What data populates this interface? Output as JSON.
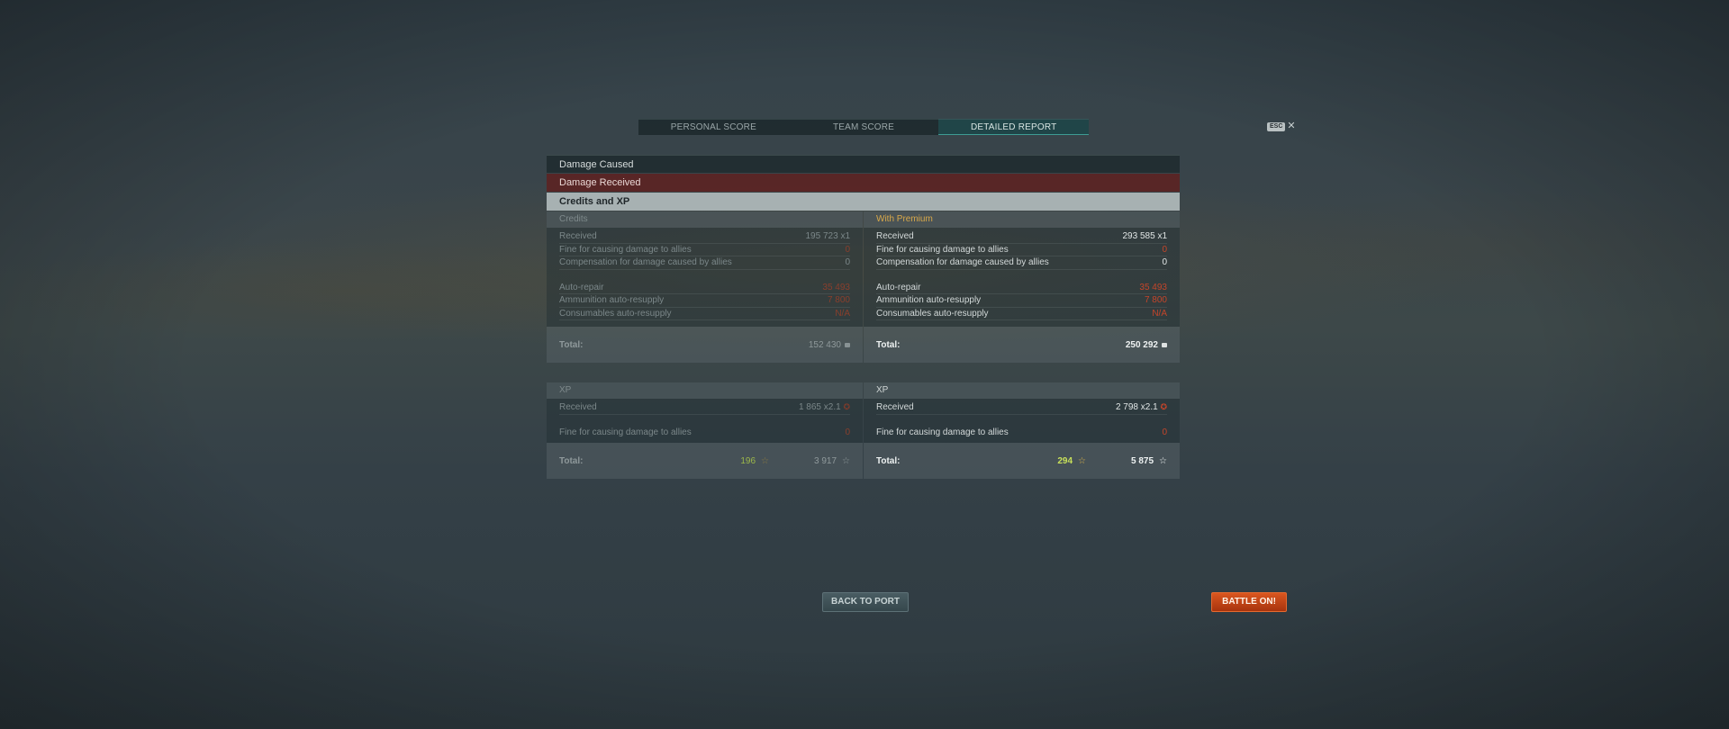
{
  "tabs": [
    {
      "label": "PERSONAL SCORE"
    },
    {
      "label": "TEAM SCORE"
    },
    {
      "label": "DETAILED REPORT"
    }
  ],
  "esc": {
    "badge": "ESC",
    "close": "✕"
  },
  "sections": {
    "damage_caused": "Damage Caused",
    "damage_received": "Damage Received",
    "credits_xp": "Credits and XP"
  },
  "credits": {
    "standard": {
      "header": "Credits",
      "received_label": "Received",
      "received_value": "195 723",
      "received_mult": "x1",
      "fine_label": "Fine for causing damage to allies",
      "fine_value": "0",
      "comp_label": "Compensation for damage caused by allies",
      "comp_value": "0",
      "repair_label": "Auto-repair",
      "repair_value": "35 493",
      "ammo_label": "Ammunition auto-resupply",
      "ammo_value": "7 800",
      "cons_label": "Consumables auto-resupply",
      "cons_value": "N/A",
      "total_label": "Total:",
      "total_value": "152 430"
    },
    "premium": {
      "header": "With Premium",
      "received_label": "Received",
      "received_value": "293 585",
      "received_mult": "x1",
      "fine_label": "Fine for causing damage to allies",
      "fine_value": "0",
      "comp_label": "Compensation for damage caused by allies",
      "comp_value": "0",
      "repair_label": "Auto-repair",
      "repair_value": "35 493",
      "ammo_label": "Ammunition auto-resupply",
      "ammo_value": "7 800",
      "cons_label": "Consumables auto-resupply",
      "cons_value": "N/A",
      "total_label": "Total:",
      "total_value": "250 292"
    }
  },
  "xp": {
    "standard": {
      "header": "XP",
      "received_label": "Received",
      "received_value": "1 865",
      "received_mult": "x2.1",
      "fine_label": "Fine for causing damage to allies",
      "fine_value": "0",
      "total_label": "Total:",
      "total_xp": "196",
      "total_free": "3 917"
    },
    "premium": {
      "header": "XP",
      "received_label": "Received",
      "received_value": "2 798",
      "received_mult": "x2.1",
      "fine_label": "Fine for causing damage to allies",
      "fine_value": "0",
      "total_label": "Total:",
      "total_xp": "294",
      "total_free": "5 875"
    }
  },
  "buttons": {
    "back": "BACK TO PORT",
    "battle": "BATTLE ON!"
  },
  "colors": {
    "accent": "#3d9c94",
    "negative": "#c4452a",
    "premium": "#d9a94a",
    "battle": "#d9561f"
  }
}
